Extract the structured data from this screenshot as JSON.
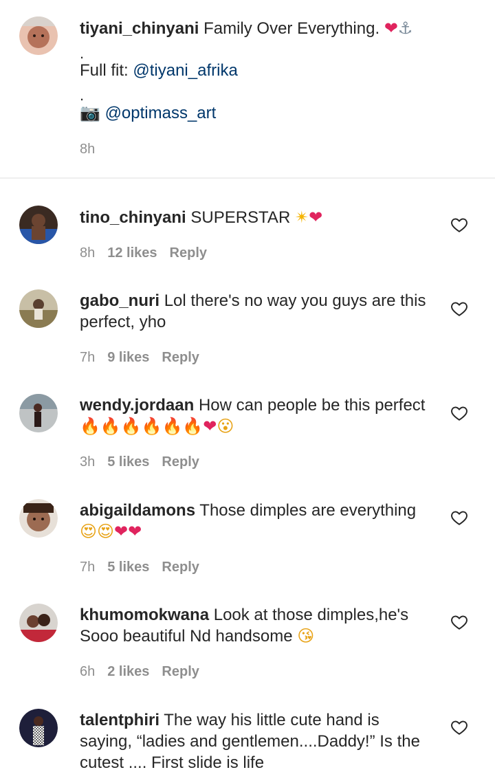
{
  "caption": {
    "username": "tiyani_chinyani",
    "text": "Family Over Everything.",
    "emojis": "❤⚓",
    "separator1": ".",
    "fullfit_label": "Full fit:",
    "fullfit_mention": "@tiyani_afrika",
    "separator2": ".",
    "camera_emoji": "📷",
    "photo_mention": "@optimass_art",
    "time": "8h"
  },
  "comments": [
    {
      "username": "tino_chinyani",
      "text": "SUPERSTAR",
      "emojis": "✴❤",
      "time": "8h",
      "likes": "12 likes",
      "reply": "Reply"
    },
    {
      "username": "gabo_nuri",
      "text": "Lol there's no way you guys are this perfect, yho",
      "emojis": "",
      "time": "7h",
      "likes": "9 likes",
      "reply": "Reply"
    },
    {
      "username": "wendy.jordaan",
      "text": "How can people be this perfect",
      "emojis": "🔥🔥🔥🔥🔥🔥❤😮",
      "time": "3h",
      "likes": "5 likes",
      "reply": "Reply"
    },
    {
      "username": "abigaildamons",
      "text": "Those dimples are everything",
      "emojis": "😍😍❤❤",
      "time": "7h",
      "likes": "5 likes",
      "reply": "Reply"
    },
    {
      "username": "khumomokwana",
      "text": "Look at those dimples,he's Sooo beautiful Nd handsome",
      "emojis": "😘",
      "time": "6h",
      "likes": "2 likes",
      "reply": "Reply"
    },
    {
      "username": "talentphiri",
      "text": "The way his little cute hand is saying, “ladies and gentlemen....Daddy!” Is the cutest .... First slide is life",
      "emojis": "",
      "time": "",
      "likes": "",
      "reply": ""
    }
  ],
  "icons": {
    "like": "heart-outline-icon"
  }
}
